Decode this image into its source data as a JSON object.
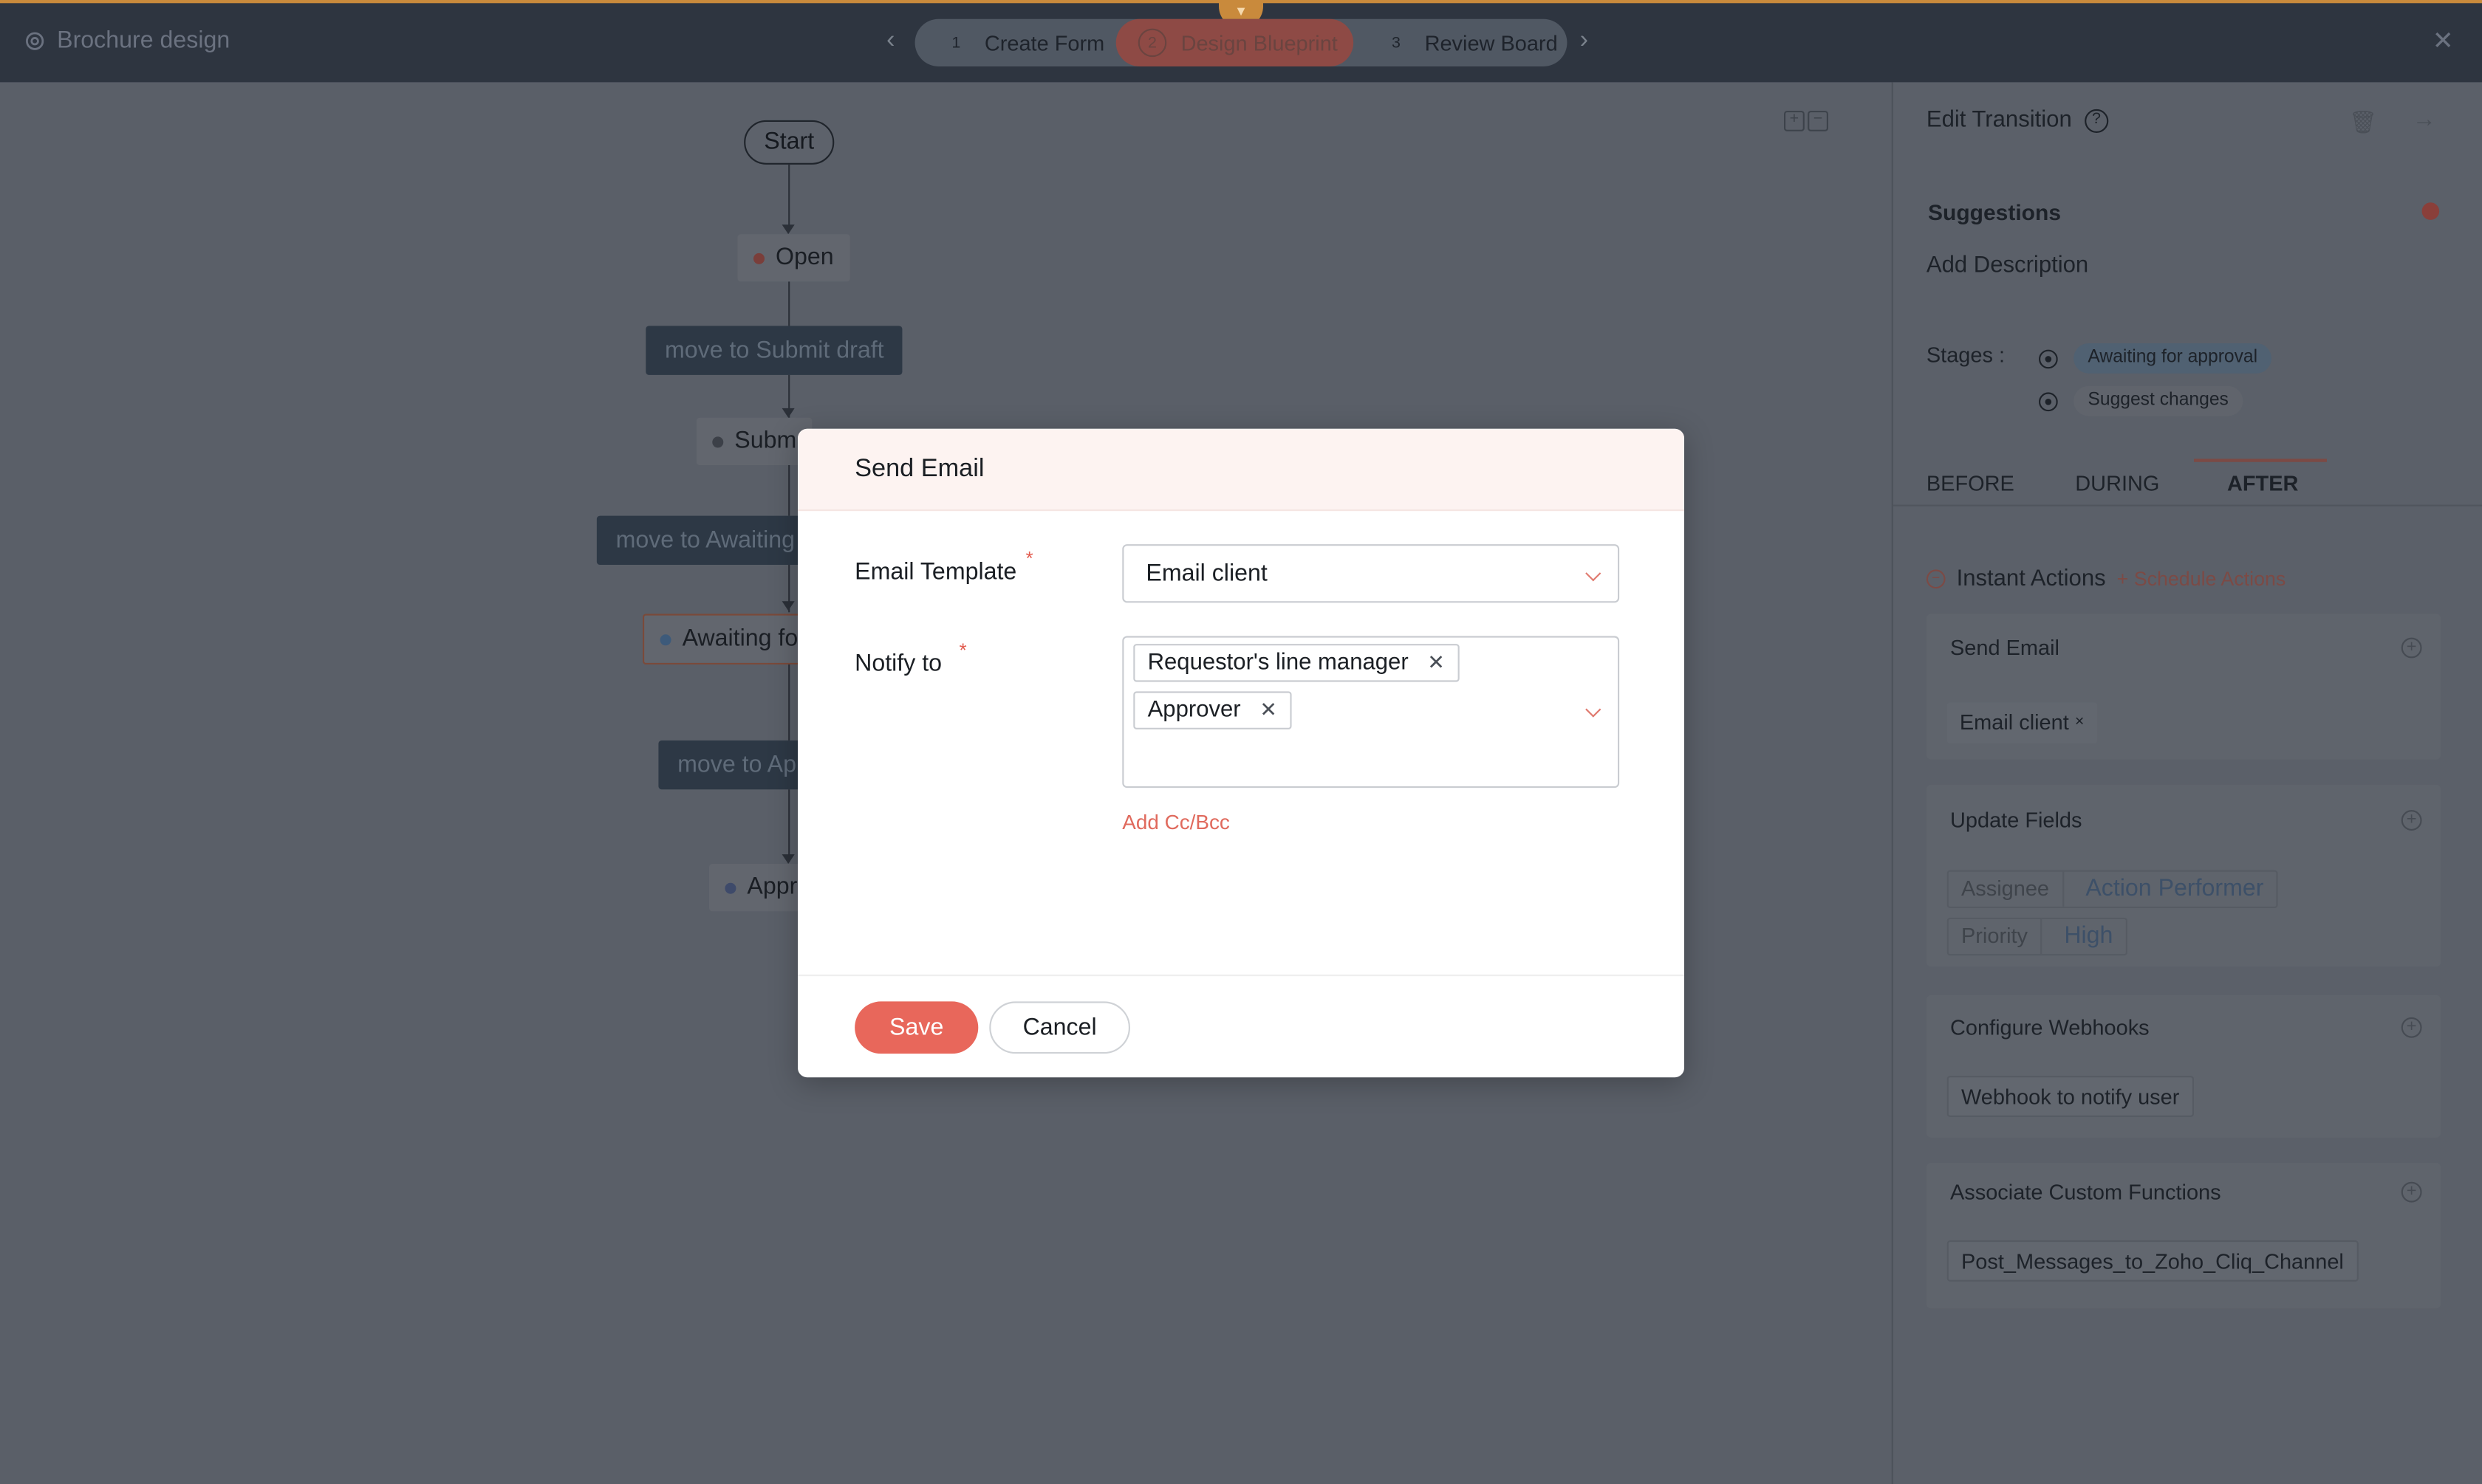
{
  "app": {
    "title": "Brochure design"
  },
  "steps": [
    {
      "num": "1",
      "label": "Create Form"
    },
    {
      "num": "2",
      "label": "Design Blueprint"
    },
    {
      "num": "3",
      "label": "Review Board"
    }
  ],
  "canvas": {
    "start": "Start",
    "states": [
      "Open",
      "Subm",
      "Awaiting fo",
      "Appr"
    ],
    "transitions": [
      "move to Submit draft",
      "move to Awaiting",
      "move to Ap"
    ]
  },
  "panel": {
    "title": "Edit Transition",
    "suggestions": "Suggestions",
    "add_description": "Add Description",
    "stages_label": "Stages :",
    "stages": [
      "Awaiting for approval",
      "Suggest changes"
    ],
    "tabs": [
      "BEFORE",
      "DURING",
      "AFTER"
    ],
    "instant_actions": "Instant Actions",
    "schedule_actions": "+ Schedule Actions",
    "send_email": {
      "title": "Send Email",
      "value": "Email client"
    },
    "update_fields": {
      "title": "Update Fields",
      "rows": [
        {
          "key": "Assignee",
          "value": "Action Performer"
        },
        {
          "key": "Priority",
          "value": "High"
        }
      ]
    },
    "webhooks": {
      "title": "Configure Webhooks",
      "value": "Webhook to notify user"
    },
    "custom_functions": {
      "title": "Associate Custom Functions",
      "value": "Post_Messages_to_Zoho_Cliq_Channel"
    }
  },
  "modal": {
    "title": "Send Email",
    "email_template_label": "Email Template",
    "email_template_value": "Email client",
    "notify_to_label": "Notify to",
    "notify_tokens": [
      "Requestor's line manager",
      "Approver"
    ],
    "add_cc": "Add Cc/Bcc",
    "save": "Save",
    "cancel": "Cancel"
  },
  "colors": {
    "accent": "#e8675b",
    "topbar": "#2e3540",
    "overlay_bg": "#5a5f68"
  }
}
